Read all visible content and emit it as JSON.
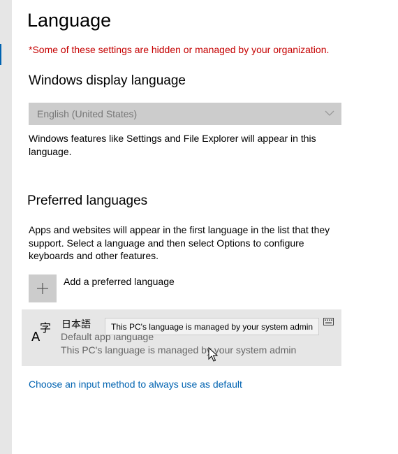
{
  "page": {
    "title": "Language",
    "warning": "*Some of these settings are hidden or managed by your organization."
  },
  "display_language": {
    "heading": "Windows display language",
    "selected": "English (United States)",
    "description": "Windows features like Settings and File Explorer will appear in this language."
  },
  "preferred": {
    "heading": "Preferred languages",
    "description": "Apps and websites will appear in the first language in the list that they support. Select a language and then select Options to configure keyboards and other features.",
    "add_label": "Add a preferred language",
    "languages": [
      {
        "name": "日本語",
        "subtitle": "Default app language",
        "note": "This PC's language is managed by your system admin",
        "icon": "language-character-icon"
      }
    ],
    "tooltip": "This PC's language is managed by your system admin"
  },
  "link": {
    "input_method": "Choose an input method to always use as default"
  },
  "colors": {
    "accent": "#0063b1",
    "warning": "#c50000",
    "disabled_field": "#cccccc",
    "row_selected": "#e6e6e6"
  }
}
